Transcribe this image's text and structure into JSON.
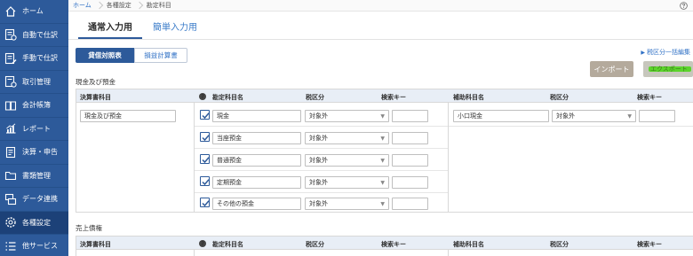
{
  "sidebar": {
    "items": [
      {
        "label": "ホーム",
        "icon": "home-icon"
      },
      {
        "label": "自動で仕訳",
        "icon": "auto-journal-icon"
      },
      {
        "label": "手動で仕訳",
        "icon": "manual-journal-icon"
      },
      {
        "label": "取引管理",
        "icon": "transaction-icon"
      },
      {
        "label": "会計帳簿",
        "icon": "ledger-icon"
      },
      {
        "label": "レポート",
        "icon": "report-icon"
      },
      {
        "label": "決算・申告",
        "icon": "settlement-icon"
      },
      {
        "label": "書類管理",
        "icon": "folder-icon"
      },
      {
        "label": "データ連携",
        "icon": "data-link-icon"
      },
      {
        "label": "各種設定",
        "icon": "gear-icon"
      },
      {
        "label": "他サービス",
        "icon": "services-icon"
      }
    ]
  },
  "breadcrumb": [
    "ホーム",
    "各種設定",
    "勘定科目"
  ],
  "tabs": {
    "normal": "通常入力用",
    "simple": "簡単入力用"
  },
  "report_toggle": {
    "bs": "貸借対照表",
    "pl": "損益計算書"
  },
  "links": {
    "bulk_tax": "税区分一括編集"
  },
  "buttons": {
    "import": "インポート",
    "export": "エクスポート"
  },
  "columns": {
    "statement_item": "決算書科目",
    "account_name": "勘定科目名",
    "tax_category": "税区分",
    "search_key": "検索キー",
    "sub_account_name": "補助科目名",
    "sub_tax_category": "税区分",
    "sub_search_key": "検索キー"
  },
  "sections": [
    {
      "title": "現金及び預金",
      "statement_item": "現金及び預金",
      "rows": [
        {
          "account": "現金",
          "tax": "対象外",
          "key": "",
          "sub_account": "小口現金",
          "sub_tax": "対象外",
          "sub_key": ""
        },
        {
          "account": "当座預金",
          "tax": "対象外",
          "key": ""
        },
        {
          "account": "普通預金",
          "tax": "対象外",
          "key": ""
        },
        {
          "account": "定期預金",
          "tax": "対象外",
          "key": ""
        },
        {
          "account": "その他の預金",
          "tax": "対象外",
          "key": ""
        }
      ]
    },
    {
      "title": "売上債権"
    }
  ],
  "colors": {
    "sidebar": "#2d5a9a",
    "accent": "#2d6fc5",
    "header_bg": "#e8eef6"
  }
}
